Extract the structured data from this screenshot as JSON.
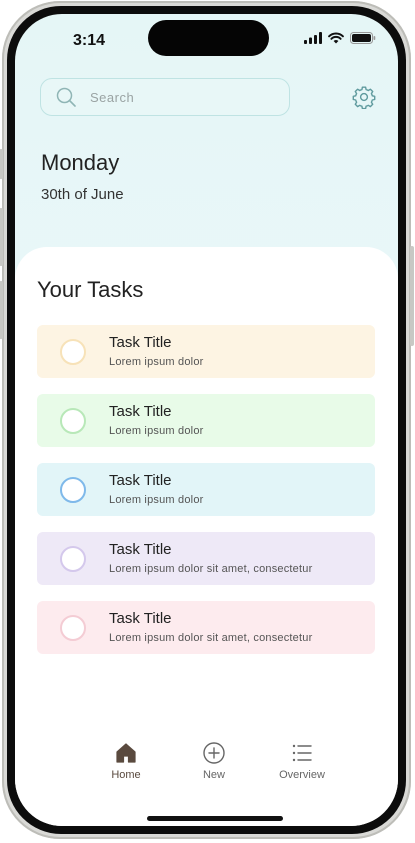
{
  "status_bar": {
    "time": "3:14"
  },
  "search": {
    "placeholder": "Search"
  },
  "header": {
    "day": "Monday",
    "date": "30th of June"
  },
  "tasks_section": {
    "title": "Your Tasks",
    "tasks": [
      {
        "title": "Task Title",
        "subtitle": "Lorem ipsum dolor",
        "bg": "#fdf4e3",
        "ring": "#f7e2b8"
      },
      {
        "title": "Task Title",
        "subtitle": "Lorem ipsum dolor",
        "bg": "#e8fbe8",
        "ring": "#b8e8b8"
      },
      {
        "title": "Task Title",
        "subtitle": "Lorem ipsum dolor",
        "bg": "#e2f5f8",
        "ring": "#7fb9ea"
      },
      {
        "title": "Task Title",
        "subtitle": "Lorem ipsum dolor sit amet, consectetur",
        "bg": "#eee9f7",
        "ring": "#d4c8ec"
      },
      {
        "title": "Task Title",
        "subtitle": "Lorem ipsum dolor sit amet, consectetur",
        "bg": "#fdebee",
        "ring": "#f4ccd4"
      }
    ]
  },
  "nav": {
    "items": [
      {
        "label": "Home",
        "icon": "home-icon",
        "active": true
      },
      {
        "label": "New",
        "icon": "plus-circle-icon",
        "active": false
      },
      {
        "label": "Overview",
        "icon": "list-icon",
        "active": false
      }
    ]
  },
  "colors": {
    "accent": "#5a4a3f",
    "icon_teal": "#5f9a9e"
  }
}
